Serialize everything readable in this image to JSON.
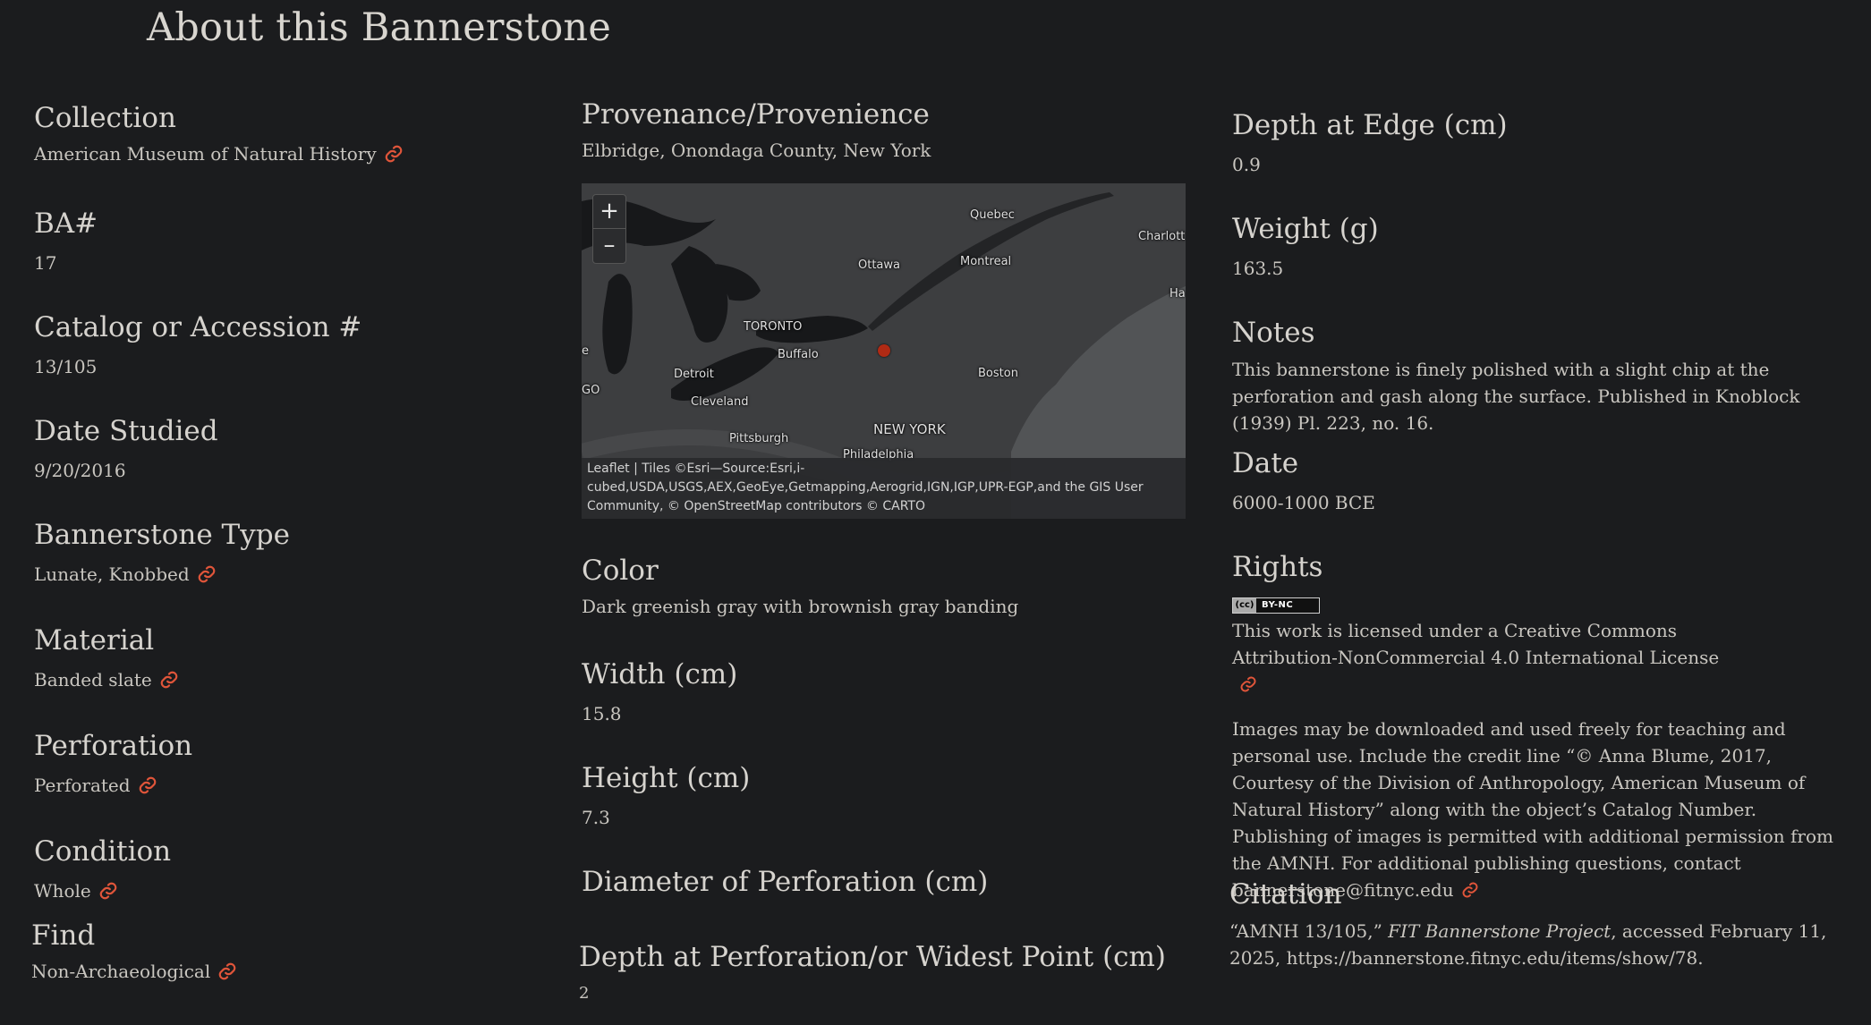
{
  "page": {
    "title": "About this Bannerstone"
  },
  "left": {
    "collection": {
      "label": "Collection",
      "value": "American Museum of Natural History"
    },
    "ba": {
      "label": "BA#",
      "value": "17"
    },
    "catalog": {
      "label": "Catalog or Accession #",
      "value": "13/105"
    },
    "date_studied": {
      "label": "Date Studied",
      "value": "9/20/2016"
    },
    "type": {
      "label": "Bannerstone Type",
      "value": "Lunate, Knobbed"
    },
    "material": {
      "label": "Material",
      "value": "Banded slate"
    },
    "perforation": {
      "label": "Perforation",
      "value": "Perforated"
    },
    "condition": {
      "label": "Condition",
      "value": "Whole"
    },
    "find": {
      "label": "Find",
      "value": "Non-Archaeological"
    }
  },
  "middle": {
    "provenance": {
      "label": "Provenance/Provenience",
      "value": "Elbridge, Onondaga County, New York"
    },
    "map": {
      "zoom_in": "+",
      "zoom_out": "–",
      "attribution": "Leaflet | Tiles ©Esri—Source:Esri,i-cubed,USDA,USGS,AEX,GeoEye,Getmapping,Aerogrid,IGN,IGP,UPR-EGP,and the GIS User Community, © OpenStreetMap contributors © CARTO",
      "cities": {
        "quebec": "Quebec",
        "charlotte": "Charlott",
        "ottawa": "Ottawa",
        "montreal": "Montreal",
        "ha": "Ha",
        "toronto": "TORONTO",
        "buffalo": "Buffalo",
        "detroit": "Detroit",
        "boston": "Boston",
        "cleveland": "Cleveland",
        "newyork": "NEW YORK",
        "pittsburgh": "Pittsburgh",
        "philadelphia": "Philadelphia",
        "e": "e",
        "go": "GO"
      },
      "colors": {
        "marker": "#b02a14"
      }
    },
    "color": {
      "label": "Color",
      "value": "Dark greenish gray with brownish gray banding"
    },
    "width": {
      "label": "Width (cm)",
      "value": "15.8"
    },
    "height": {
      "label": "Height (cm)",
      "value": "7.3"
    },
    "diameter": {
      "label": "Diameter of Perforation (cm)"
    },
    "depth_perf": {
      "label": "Depth at Perforation/or Widest Point (cm)",
      "value": "2"
    }
  },
  "right": {
    "depth_edge": {
      "label": "Depth at Edge (cm)",
      "value": "0.9"
    },
    "weight": {
      "label": "Weight (g)",
      "value": "163.5"
    },
    "notes": {
      "label": "Notes",
      "value": "This bannerstone is finely polished with a slight chip at the perforation and gash along the surface. Published in Knoblock (1939) Pl. 223, no. 16."
    },
    "date": {
      "label": "Date",
      "value": "6000-1000 BCE"
    },
    "rights": {
      "label": "Rights",
      "badge_left": "(cc)",
      "badge_right": "BY-NC",
      "license_prefix": "This work is licensed under a ",
      "license_link": "Creative Commons Attribution-NonCommercial 4.0 International License",
      "usage_text": "Images may be downloaded and used freely for teaching and personal use. Include the credit line “© Anna Blume, 2017, Courtesy of the Division of Anthropology, American Museum of Natural History” along with the object’s Catalog Number. Publishing of images is permitted with additional permission from the AMNH. For additional publishing questions, contact ",
      "contact_email": "bannerstone@fitnyc.edu"
    },
    "citation": {
      "label": "Citation",
      "prefix": "“AMNH 13/105,” ",
      "project": "FIT Bannerstone Project",
      "suffix": ", accessed February 11, 2025, https://bannerstone.fitnyc.edu/items/show/78."
    }
  },
  "icons": {
    "link": "link-icon"
  },
  "colors": {
    "background": "#1b1c1e",
    "text": "#d4d1cc",
    "link_icon": "#e0553a"
  }
}
